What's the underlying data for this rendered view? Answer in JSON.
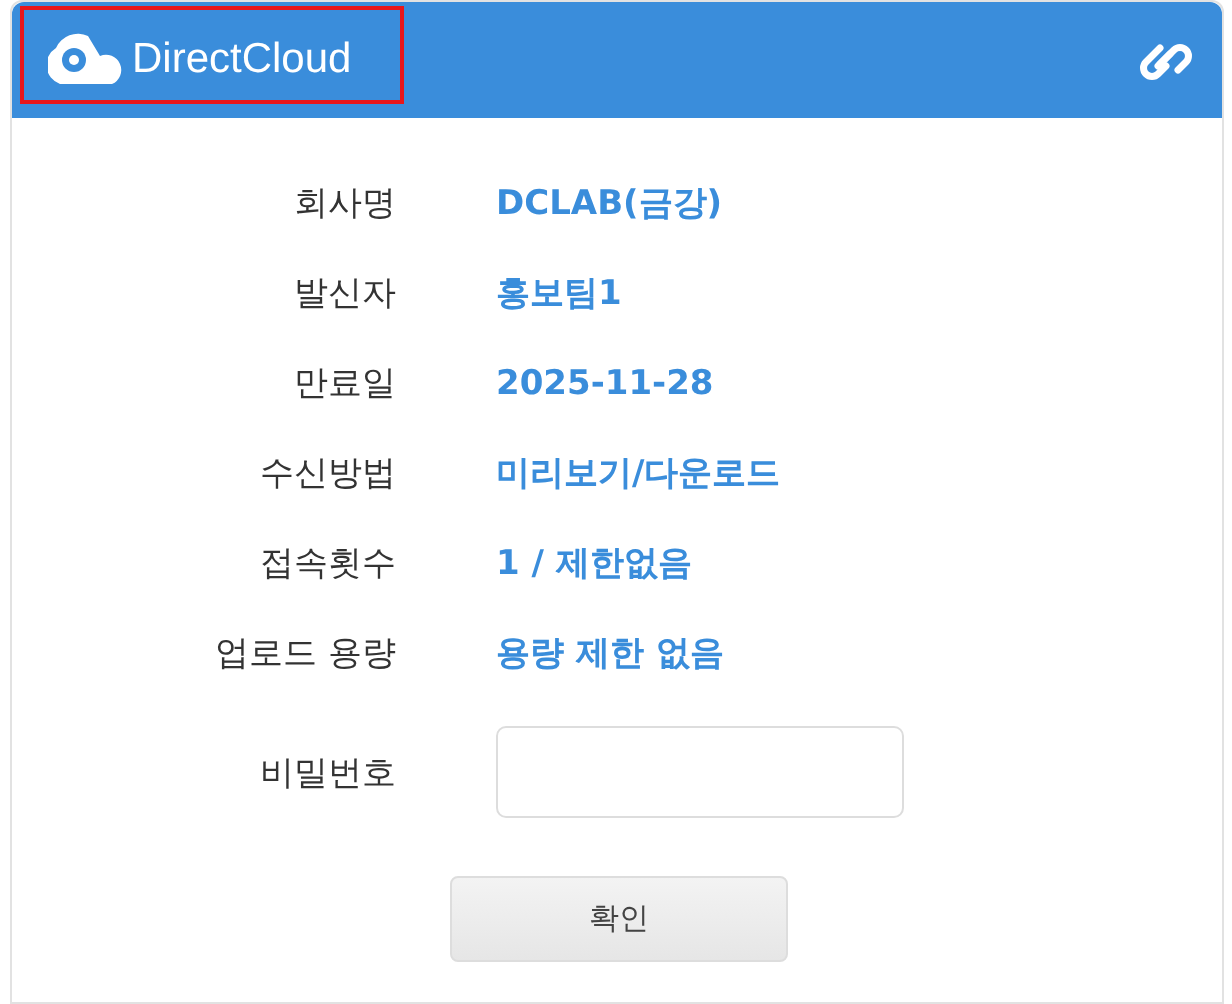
{
  "header": {
    "logo_text": "DirectCloud",
    "highlighted": true
  },
  "fields": [
    {
      "label": "회사명",
      "value": "DCLAB(금강)"
    },
    {
      "label": "발신자",
      "value": "홍보팀1"
    },
    {
      "label": "만료일",
      "value": "2025-11-28"
    },
    {
      "label": "수신방법",
      "value": "미리보기/다운로드"
    },
    {
      "label": "접속횟수",
      "value": "1 / 제한없음"
    },
    {
      "label": "업로드 용량",
      "value": "용량 제한 없음"
    }
  ],
  "password": {
    "label": "비밀번호"
  },
  "buttons": [
    "확인"
  ]
}
